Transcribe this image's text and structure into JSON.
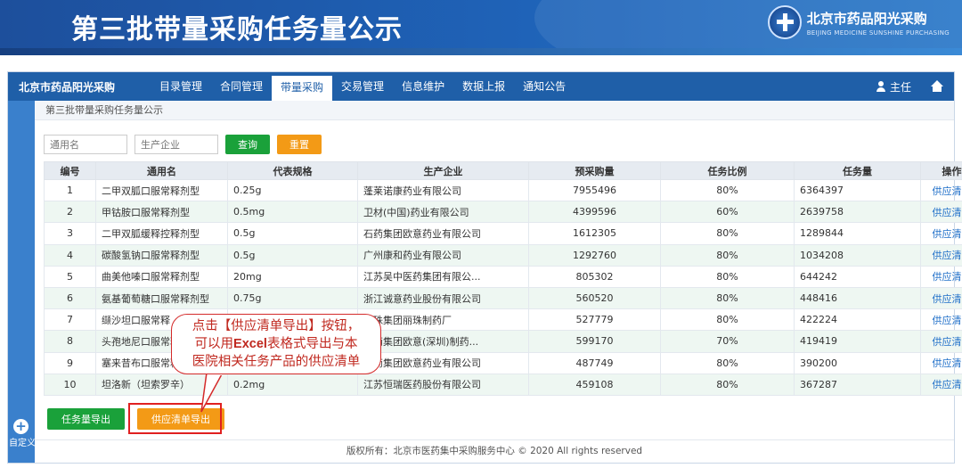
{
  "slide": {
    "title": "第三批带量采购任务量公示",
    "brand_cn": "北京市药品阳光采购",
    "brand_en": "BEIJING MEDICINE SUNSHINE PURCHASING"
  },
  "app": {
    "brand": "北京市药品阳光采购",
    "menu": [
      "目录管理",
      "合同管理",
      "带量采购",
      "交易管理",
      "信息维护",
      "数据上报",
      "通知公告"
    ],
    "active_menu": "带量采购",
    "user": "主任",
    "breadcrumb": "第三批带量采购任务量公示",
    "sidebar_label": "自定义"
  },
  "search": {
    "generic_placeholder": "通用名",
    "manufacturer_placeholder": "生产企业",
    "query_label": "查询",
    "reset_label": "重置"
  },
  "table": {
    "headers": [
      "编号",
      "通用名",
      "代表规格",
      "生产企业",
      "预采购量",
      "任务比例",
      "任务量",
      "操作"
    ],
    "rows": [
      [
        "1",
        "二甲双胍口服常释剂型",
        "0.25g",
        "蓬莱诺康药业有限公司",
        "7955496",
        "80%",
        "6364397",
        "供应清单"
      ],
      [
        "2",
        "甲钴胺口服常释剂型",
        "0.5mg",
        "卫材(中国)药业有限公司",
        "4399596",
        "60%",
        "2639758",
        "供应清单"
      ],
      [
        "3",
        "二甲双胍缓释控释剂型",
        "0.5g",
        "石药集团欧意药业有限公司",
        "1612305",
        "80%",
        "1289844",
        "供应清单"
      ],
      [
        "4",
        "碳酸氢钠口服常释剂型",
        "0.5g",
        "广州康和药业有限公司",
        "1292760",
        "80%",
        "1034208",
        "供应清单"
      ],
      [
        "5",
        "曲美他嗪口服常释剂型",
        "20mg",
        "江苏吴中医药集团有限公...",
        "805302",
        "80%",
        "644242",
        "供应清单"
      ],
      [
        "6",
        "氨基葡萄糖口服常释剂型",
        "0.75g",
        "浙江诚意药业股份有限公司",
        "560520",
        "80%",
        "448416",
        "供应清单"
      ],
      [
        "7",
        "缬沙坦口服常释",
        "",
        "丽珠集团丽珠制药厂",
        "527779",
        "80%",
        "422224",
        "供应清单"
      ],
      [
        "8",
        "头孢地尼口服常释",
        "",
        "石药集团欧意(深圳)制药...",
        "599170",
        "70%",
        "419419",
        "供应清单"
      ],
      [
        "9",
        "塞来昔布口服常释",
        "",
        "石药集团欧意药业有限公司",
        "487749",
        "80%",
        "390200",
        "供应清单"
      ],
      [
        "10",
        "坦洛新（坦索罗辛）",
        "0.2mg",
        "江苏恒瑞医药股份有限公司",
        "459108",
        "80%",
        "367287",
        "供应清单"
      ]
    ]
  },
  "actions": {
    "export_task": "任务量导出",
    "export_supply": "供应清单导出"
  },
  "footer": "版权所有：北京市医药集中采购服务中心 © 2020 All rights reserved",
  "callout": {
    "line1": "点击【供应清单导出】按钮，",
    "line2_pre": "可以用",
    "line2_bold": "Excel",
    "line2_post": "表格式导出与本",
    "line3": "医院相关任务产品的供应清单"
  }
}
